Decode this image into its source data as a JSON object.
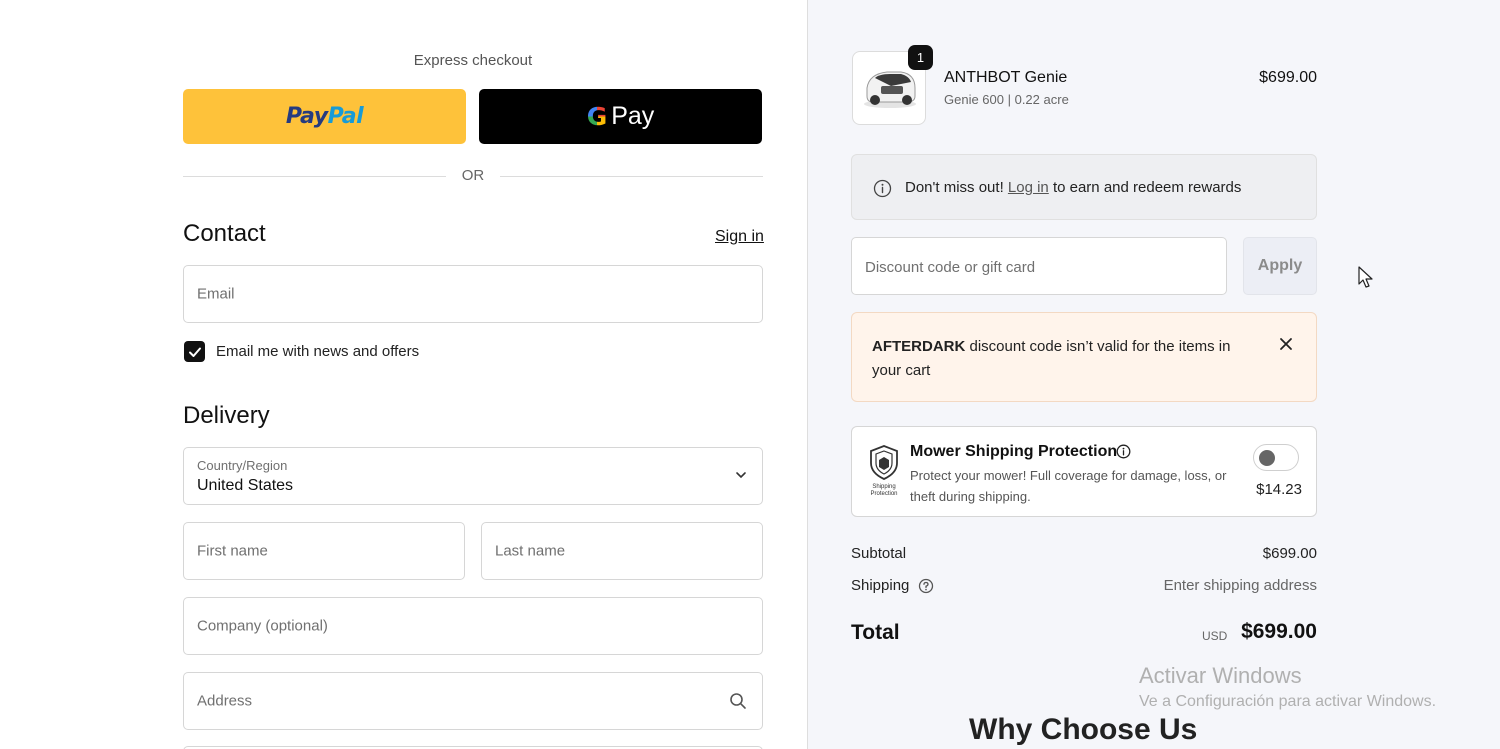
{
  "express": {
    "title": "Express checkout",
    "paypal_label_1": "Pay",
    "paypal_label_2": "Pal",
    "gpay_g": "G",
    "gpay_label": "Pay"
  },
  "divider": {
    "or_label": "OR"
  },
  "contact": {
    "heading": "Contact",
    "sign_in": "Sign in",
    "email_placeholder": "Email",
    "newsletter_label": "Email me with news and offers",
    "newsletter_checked": true
  },
  "delivery": {
    "heading": "Delivery",
    "country_label": "Country/Region",
    "country_value": "United States",
    "first_name_placeholder": "First name",
    "last_name_placeholder": "Last name",
    "company_placeholder": "Company (optional)",
    "address_placeholder": "Address"
  },
  "cart": {
    "item": {
      "quantity": "1",
      "name": "ANTHBOT Genie",
      "variant": "Genie 600 | 0.22 acre",
      "price": "$699.00"
    }
  },
  "rewards": {
    "text_before": "Don't miss out! ",
    "link": "Log in",
    "text_after": " to earn and redeem rewards"
  },
  "discount": {
    "placeholder": "Discount code or gift card",
    "apply_label": "Apply"
  },
  "alert": {
    "code": "AFTERDARK",
    "message": " discount code isn’t valid for the items in your cart"
  },
  "protection": {
    "title": "Mower Shipping Protection",
    "description": "Protect your mower! Full coverage for damage, loss, or theft during shipping.",
    "price": "$14.23",
    "enabled": false,
    "shield_caption": "Shipping Protection"
  },
  "summary": {
    "subtotal_label": "Subtotal",
    "subtotal_value": "$699.00",
    "shipping_label": "Shipping",
    "shipping_value": "Enter shipping address",
    "total_label": "Total",
    "total_currency": "USD",
    "total_value": "$699.00"
  },
  "watermark": {
    "title": "Activar Windows",
    "subtitle": "Ve a Configuración para activar Windows."
  },
  "footer": {
    "heading": "Why Choose Us"
  },
  "colors": {
    "paypal_bg": "#fec23a",
    "gpay_bg": "#000000",
    "summary_bg": "#f5f6fa",
    "alert_bg": "#fff4eb"
  }
}
